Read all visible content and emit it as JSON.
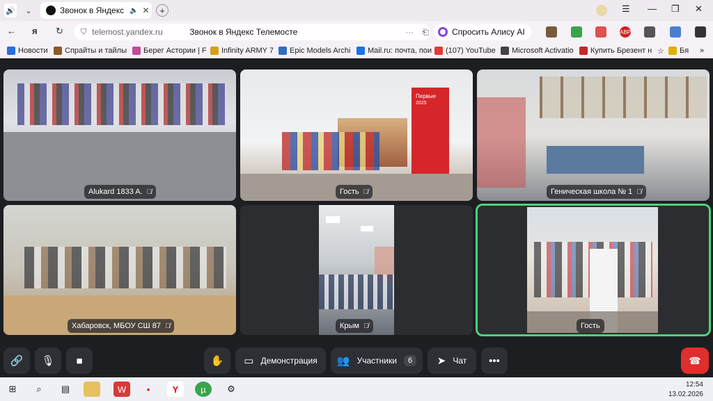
{
  "browser": {
    "tab_title": "Звонок в Яндекс Теле",
    "url": "telemost.yandex.ru",
    "page_title": "Звонок в Яндекс Телемосте",
    "alice_button": "Спросить Алису AI",
    "ext_abp_label": "ABP"
  },
  "bookmarks": [
    {
      "label": "Новости",
      "color": "#2a6fdb"
    },
    {
      "label": "Спрайты и тайлы",
      "color": "#8a5a2a"
    },
    {
      "label": "Берег Астории | F",
      "color": "#c24a9a"
    },
    {
      "label": "Infinity ARMY 7",
      "color": "#d4a017"
    },
    {
      "label": "Epic Models Archi",
      "color": "#2f6fbf"
    },
    {
      "label": "Mail.ru: почта, пои",
      "color": "#1a73e8"
    },
    {
      "label": "(107) YouTube",
      "color": "#e53935"
    },
    {
      "label": "Microsoft Activatio",
      "color": "#444444"
    },
    {
      "label": "Купить Брезент н",
      "color": "#c62828"
    },
    {
      "label": "Бя",
      "color": "#e0b000"
    }
  ],
  "participants": [
    {
      "name": "Alukard 1833 A."
    },
    {
      "name": "Гость"
    },
    {
      "name": "Геническая школа № 1"
    },
    {
      "name": "Хабаровск, МБОУ СШ 87"
    },
    {
      "name": "Крым"
    },
    {
      "name": "Гость"
    }
  ],
  "controls": {
    "screen_share": "Демонстрация",
    "participants_label": "Участники",
    "participants_count": "6",
    "chat": "Чат"
  },
  "banner_text": "Первые",
  "banner_year": "2025",
  "taskbar": {
    "time": "12:54",
    "date": "13.02.2026"
  }
}
